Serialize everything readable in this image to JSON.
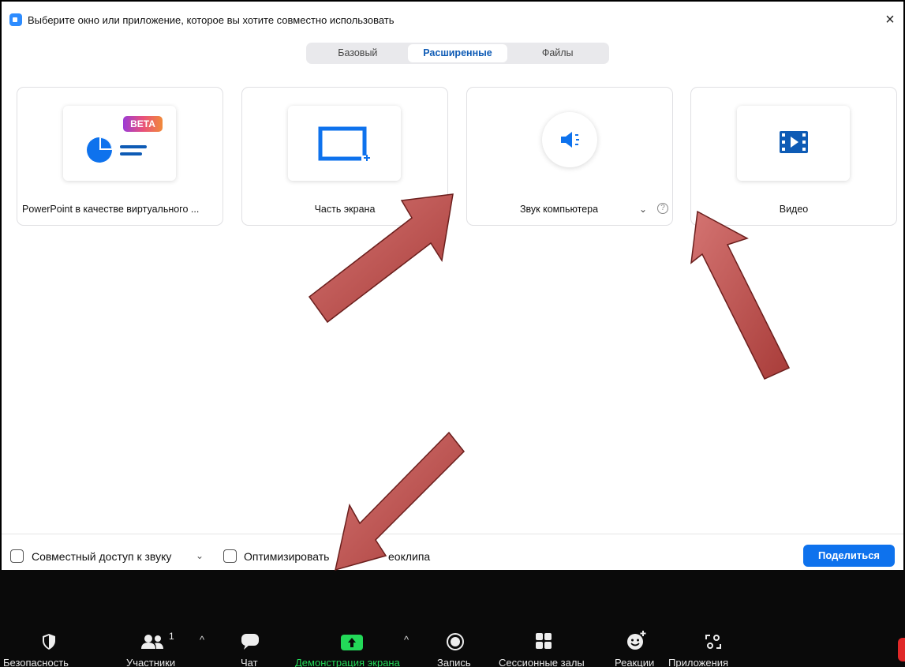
{
  "window": {
    "title": "Выберите окно или приложение, которое вы хотите совместно использовать",
    "close": "×"
  },
  "tabs": [
    {
      "label": "Базовый",
      "active": false
    },
    {
      "label": "Расширенные",
      "active": true
    },
    {
      "label": "Файлы",
      "active": false
    }
  ],
  "cards": [
    {
      "label": "PowerPoint в качестве виртуального ...",
      "icon": "powerpoint-slide-icon",
      "badge": "BETA"
    },
    {
      "label": "Часть экрана",
      "icon": "screen-portion-icon"
    },
    {
      "label": "Звук компьютера",
      "icon": "speaker-icon"
    },
    {
      "label": "Видео",
      "icon": "video-film-icon"
    }
  ],
  "footer": {
    "share_audio": "Совместный доступ к звуку",
    "optimize_prefix": "Оптимизировать",
    "optimize_suffix": "еоклипа",
    "share_button": "Поделиться"
  },
  "toolbar": {
    "security": "Безопасность",
    "participants": "Участники",
    "participants_count": "1",
    "chat": "Чат",
    "share_screen": "Демонстрация экрана",
    "record": "Запись",
    "breakout": "Сессионные залы",
    "reactions": "Реакции",
    "apps": "Приложения"
  },
  "colors": {
    "accent": "#0e72ed",
    "active_tab": "#0e5bb5",
    "share_green": "#23d959",
    "arrow_fill": "#c0504d"
  }
}
